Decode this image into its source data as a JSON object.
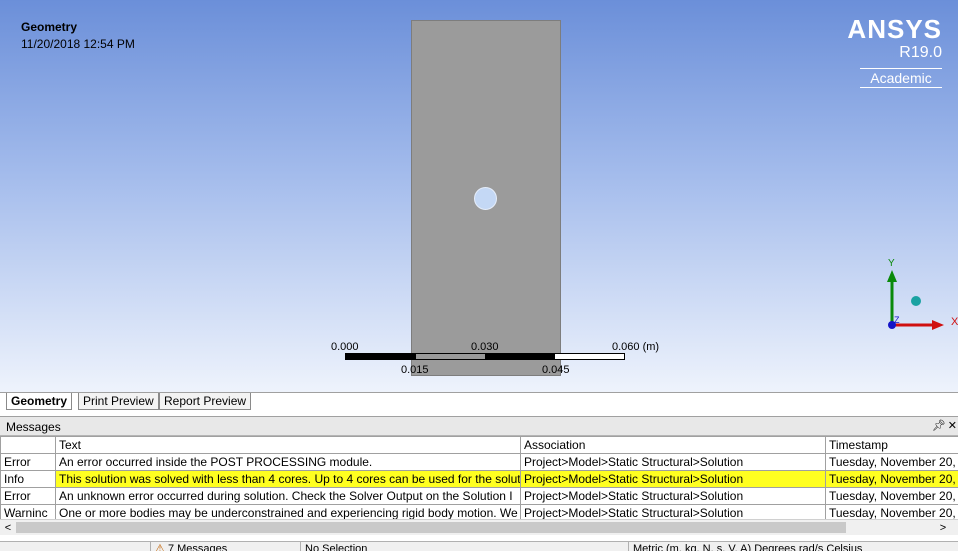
{
  "viewport": {
    "title": "Geometry",
    "date": "11/20/2018 12:54 PM",
    "logo": {
      "name": "ANSYS",
      "version": "R19.0",
      "edition": "Academic"
    },
    "scale": {
      "top_labels": [
        "0.000",
        "0.030",
        "0.060 (m)"
      ],
      "bottom_labels": [
        "0.015",
        "0.045"
      ]
    },
    "triad": {
      "y_label": "Y",
      "x_label": "X",
      "z_label": "Z"
    },
    "colors": {
      "bg_top": "#6b8fd9",
      "bg_bottom": "#eef3fc",
      "plate": "#9b9b9b",
      "highlight": "#ffff20"
    }
  },
  "tabs": [
    {
      "label": "Geometry",
      "active": true
    },
    {
      "label": "Print Preview",
      "active": false
    },
    {
      "label": "Report Preview",
      "active": false
    }
  ],
  "messages": {
    "title": "Messages",
    "columns": [
      "",
      "Text",
      "Association",
      "Timestamp"
    ],
    "rows": [
      {
        "type": "Error",
        "text": "An error occurred inside the POST PROCESSING module.",
        "association": "Project>Model>Static Structural>Solution",
        "timestamp": "Tuesday, November 20,"
      },
      {
        "type": "Info",
        "text": "This solution was solved with less than 4 cores.  Up to 4 cores can be used for the soluti",
        "association": "Project>Model>Static Structural>Solution",
        "timestamp": "Tuesday, November 20,",
        "highlight": true
      },
      {
        "type": "Error",
        "text": "An unknown error occurred during solution.  Check the Solver Output on the Solution I",
        "association": "Project>Model>Static Structural>Solution",
        "timestamp": "Tuesday, November 20,"
      },
      {
        "type": "Warninc",
        "text": "One or more bodies may be underconstrained and experiencing rigid body motion. We",
        "association": "Project>Model>Static Structural>Solution",
        "timestamp": "Tuesday, November 20,"
      }
    ]
  },
  "statusbar": {
    "messages": "7 Messages",
    "selection": "No Selection",
    "units": "Metric (m, kg, N, s, V, A)   Degrees   rad/s   Celsius"
  }
}
